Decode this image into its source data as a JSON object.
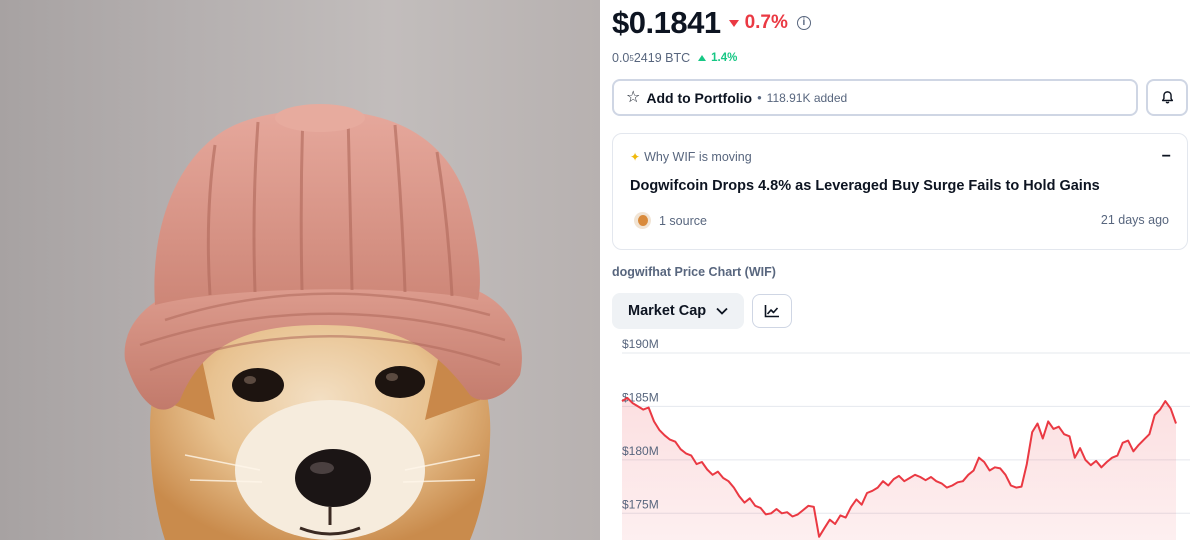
{
  "price": {
    "value": "$0.1841",
    "change": "0.7%",
    "info_icon": "info-icon"
  },
  "btc": {
    "prefix": "0.0",
    "sub": "5",
    "suffix": "2419 BTC",
    "change": "1.4%"
  },
  "portfolio": {
    "label": "Add to Portfolio",
    "separator": "•",
    "added": "118.91K added",
    "star_icon": "star-icon",
    "bell_icon": "bell-icon"
  },
  "why": {
    "header": "Why WIF is moving",
    "collapse_symbol": "−",
    "headline": "Dogwifcoin Drops 4.8% as Leveraged Buy Surge Fails to Hold Gains",
    "source": "1 source",
    "time": "21 days ago"
  },
  "chart_title": "dogwifhat Price Chart (WIF)",
  "controls": {
    "metric": "Market Cap",
    "line_icon": "line-chart-icon"
  },
  "colors": {
    "down": "#ea3943",
    "up": "#16c784",
    "line": "#ea3943"
  },
  "chart_data": {
    "type": "area",
    "y_ticks": [
      "$190M",
      "$185M",
      "$180M",
      "$175M"
    ],
    "ylim": [
      172.5,
      190
    ],
    "series": [
      {
        "values": [
          185.5,
          185.8,
          185.3,
          185.0,
          184.7,
          184.9,
          183.6,
          182.8,
          182.3,
          181.9,
          181.7,
          181.0,
          180.6,
          180.4,
          179.6,
          179.8,
          179.1,
          178.6,
          178.9,
          178.3,
          178.0,
          177.4,
          176.6,
          176.0,
          176.4,
          175.7,
          175.5,
          174.9,
          175.0,
          175.4,
          175.0,
          175.1,
          174.7,
          174.9,
          175.3,
          175.7,
          175.6,
          172.8,
          173.6,
          174.4,
          174.0,
          174.8,
          174.6,
          175.6,
          176.3,
          175.8,
          176.9,
          177.1,
          177.4,
          178.0,
          177.6,
          178.2,
          178.5,
          178.0,
          178.3,
          178.6,
          178.4,
          178.1,
          178.4,
          178.0,
          177.8,
          177.4,
          177.6,
          177.9,
          178.0,
          178.6,
          179.0,
          180.2,
          179.8,
          179.0,
          179.3,
          179.2,
          178.6,
          177.6,
          177.4,
          177.5,
          179.6,
          182.6,
          183.4,
          182.0,
          183.6,
          182.9,
          183.1,
          182.4,
          182.2,
          180.2,
          181.1,
          180.0,
          179.5,
          179.9,
          179.3,
          179.8,
          180.2,
          180.4,
          181.6,
          181.8,
          180.8,
          181.4,
          181.9,
          182.4,
          184.2,
          184.7,
          185.5,
          184.8,
          183.4
        ]
      }
    ]
  }
}
